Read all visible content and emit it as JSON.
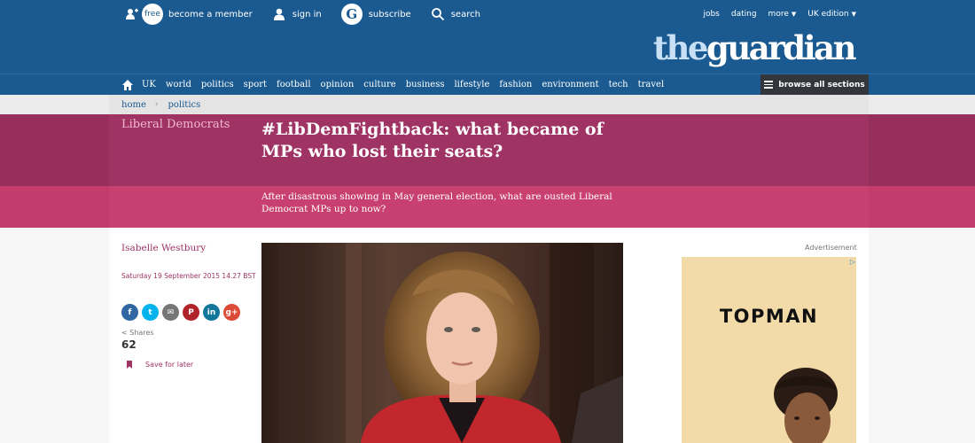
{
  "topbar": {
    "free_badge": "free",
    "become_member": "become a member",
    "sign_in": "sign in",
    "subscribe": "subscribe",
    "search": "search",
    "jobs": "jobs",
    "dating": "dating",
    "more": "more",
    "edition": "UK edition"
  },
  "logo": {
    "the": "the",
    "guardian": "guardian"
  },
  "nav": {
    "items": [
      "UK",
      "world",
      "politics",
      "sport",
      "football",
      "opinion",
      "culture",
      "business",
      "lifestyle",
      "fashion",
      "environment",
      "tech",
      "travel"
    ],
    "browse": "browse all sections"
  },
  "breadcrumb": {
    "home": "home",
    "separator": "›",
    "section": "politics"
  },
  "article": {
    "section": "Liberal Democrats",
    "headline": "#LibDemFightback: what became of MPs who lost their seats?",
    "standfirst": "After disastrous showing in May general election, what are ousted Liberal Democrat MPs up to now?",
    "author": "Isabelle Westbury",
    "dateline": "Saturday 19 September 2015 14.27 BST",
    "shares_label": "Shares",
    "shares_count": "62",
    "save_label": "Save for later"
  },
  "share_buttons": [
    {
      "name": "facebook",
      "glyph": "f",
      "color": "#3067a3"
    },
    {
      "name": "twitter",
      "glyph": "t",
      "color": "#03b3ee"
    },
    {
      "name": "email",
      "glyph": "✉",
      "color": "#767676"
    },
    {
      "name": "pinterest",
      "glyph": "P",
      "color": "#b0232a"
    },
    {
      "name": "linkedin",
      "glyph": "in",
      "color": "#13779b"
    },
    {
      "name": "googleplus",
      "glyph": "g+",
      "color": "#dc4a38"
    }
  ],
  "ad": {
    "label": "Advertisement",
    "brand": "TOPMAN",
    "choice_icon": "▷"
  },
  "colors": {
    "brand_blue": "#1a5a90",
    "section_dark": "#9e3364",
    "section_light": "#c7406f"
  }
}
